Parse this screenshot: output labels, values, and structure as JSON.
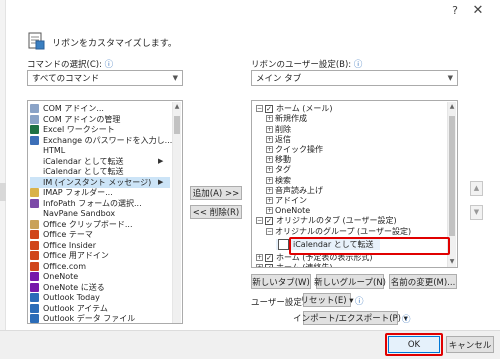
{
  "window": {
    "help_glyph": "?",
    "close_glyph": "✕"
  },
  "header": {
    "title": "リボンをカスタマイズします。"
  },
  "commands": {
    "label": "コマンドの選択(C):",
    "selected": "すべてのコマンド",
    "items": [
      {
        "label": "COM アドイン...",
        "icon": "com-addin-icon",
        "color": "#8aa3c7"
      },
      {
        "label": "COM アドインの管理",
        "icon": "com-addin-manage-icon",
        "color": "#8aa3c7"
      },
      {
        "label": "Excel ワークシート",
        "icon": "excel-icon",
        "color": "#1e7145"
      },
      {
        "label": "Exchange のパスワードを入力し...",
        "icon": "exchange-icon",
        "color": "#3c6fb8"
      },
      {
        "label": "HTML",
        "icon": "",
        "color": ""
      },
      {
        "label": "iCalendar として転送",
        "icon": "",
        "color": "",
        "has_submenu": true
      },
      {
        "label": "iCalendar として転送",
        "icon": "",
        "color": ""
      },
      {
        "label": "IM (インスタント メッセージ)",
        "icon": "",
        "color": "",
        "has_submenu": true,
        "selected": true
      },
      {
        "label": "IMAP フォルダー...",
        "icon": "imap-folder-icon",
        "color": "#d9b24a"
      },
      {
        "label": "InfoPath フォームの選択...",
        "icon": "infopath-icon",
        "color": "#7c4aa8"
      },
      {
        "label": "NavPane Sandbox",
        "icon": "",
        "color": ""
      },
      {
        "label": "Office クリップボード...",
        "icon": "clipboard-icon",
        "color": "#c9a25a"
      },
      {
        "label": "Office テーマ",
        "icon": "office-theme-icon",
        "color": "#d0451b"
      },
      {
        "label": "Office Insider",
        "icon": "office-insider-icon",
        "color": "#d0451b"
      },
      {
        "label": "Office 用アドイン",
        "icon": "office-addin-icon",
        "color": "#d0451b"
      },
      {
        "label": "Office.com",
        "icon": "office-com-icon",
        "color": "#d0451b"
      },
      {
        "label": "OneNote",
        "icon": "onenote-icon",
        "color": "#7719aa"
      },
      {
        "label": "OneNote に送る",
        "icon": "send-to-onenote-icon",
        "color": "#7719aa"
      },
      {
        "label": "Outlook Today",
        "icon": "outlook-today-icon",
        "color": "#2b6cb8"
      },
      {
        "label": "Outlook アイテム",
        "icon": "outlook-item-icon",
        "color": "#2b6cb8"
      },
      {
        "label": "Outlook データ ファイル",
        "icon": "outlook-data-file-icon",
        "color": "#2b6cb8"
      }
    ]
  },
  "ribbon": {
    "label": "リボンのユーザー設定(B):",
    "selected": "メイン タブ",
    "items": [
      {
        "label": "ホーム (メール)",
        "level": 0,
        "expander": "⊟",
        "checkbox": true
      },
      {
        "label": "新規作成",
        "level": 1,
        "expander": "⊞"
      },
      {
        "label": "削除",
        "level": 1,
        "expander": "⊞"
      },
      {
        "label": "返信",
        "level": 1,
        "expander": "⊞"
      },
      {
        "label": "クイック操作",
        "level": 1,
        "expander": "⊞"
      },
      {
        "label": "移動",
        "level": 1,
        "expander": "⊞"
      },
      {
        "label": "タグ",
        "level": 1,
        "expander": "⊞"
      },
      {
        "label": "検索",
        "level": 1,
        "expander": "⊞"
      },
      {
        "label": "音声読み上げ",
        "level": 1,
        "expander": "⊞"
      },
      {
        "label": "アドイン",
        "level": 1,
        "expander": "⊞"
      },
      {
        "label": "OneNote",
        "level": 1,
        "expander": "⊞"
      },
      {
        "label": "オリジナルのタブ (ユーザー設定)",
        "level": 0,
        "expander": "⊟",
        "checkbox": true
      },
      {
        "label": "オリジナルのグループ (ユーザー設定)",
        "level": 1,
        "expander": "⊟"
      },
      {
        "label": "iCalendar として転送",
        "level": 2,
        "expander": "",
        "highlighted": true
      },
      {
        "label": "ホーム (予定表の表示形式)",
        "level": 0,
        "expander": "⊞",
        "checkbox": true
      },
      {
        "label": "ホーム (連絡先)",
        "level": 0,
        "expander": "⊞",
        "checkbox": true
      }
    ]
  },
  "buttons": {
    "add": "追加(A) >>",
    "remove": "<< 削除(R)",
    "new_tab": "新しいタブ(W)",
    "new_group": "新しいグループ(N)",
    "rename": "名前の変更(M)...",
    "reset": "リセット(E) ▾",
    "import_export": "インポート/エクスポート(P) ▾",
    "ok": "OK",
    "cancel": "キャンセル"
  },
  "user_settings": {
    "label": "ユーザー設定:"
  },
  "accent": {
    "highlight_border": "#e00000",
    "selection_bg": "#cce4f7"
  }
}
